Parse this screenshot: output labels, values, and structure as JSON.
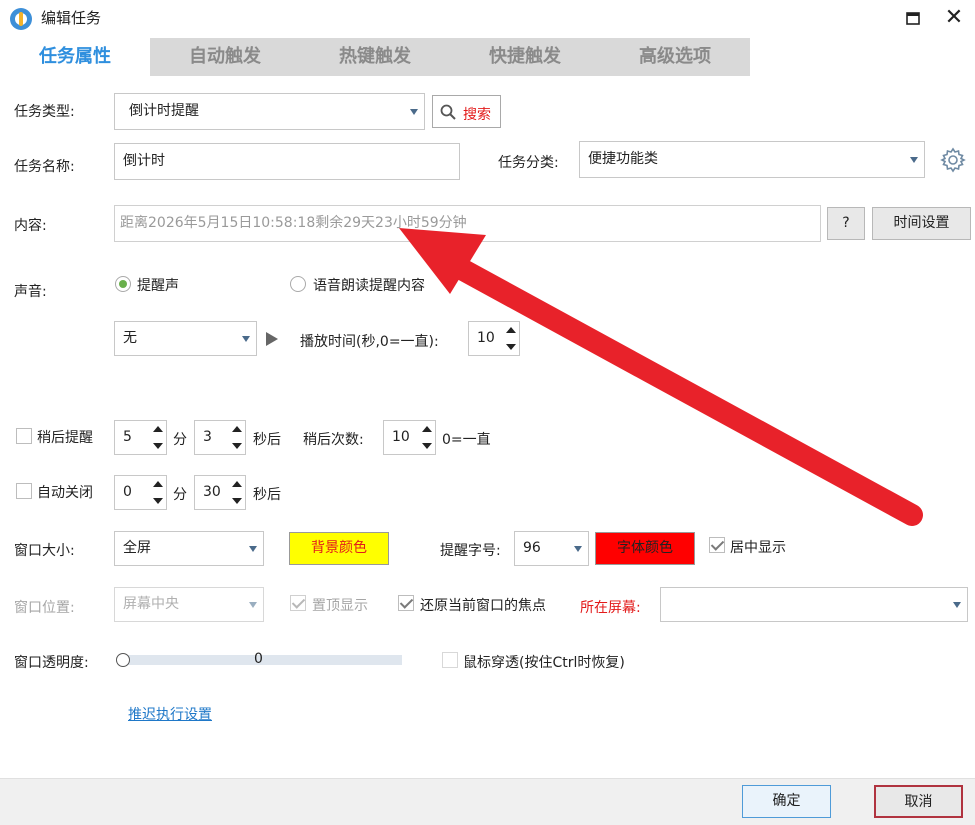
{
  "window": {
    "title": "编辑任务",
    "close_glyph": "✕"
  },
  "tabs": [
    {
      "label": "任务属性",
      "active": true
    },
    {
      "label": "自动触发",
      "active": false
    },
    {
      "label": "热键触发",
      "active": false
    },
    {
      "label": "快捷触发",
      "active": false
    },
    {
      "label": "高级选项",
      "active": false
    }
  ],
  "task": {
    "type_label": "任务类型:",
    "type_value": "倒计时提醒",
    "search_label": "搜索",
    "name_label": "任务名称:",
    "name_value": "倒计时",
    "category_label": "任务分类:",
    "category_value": "便捷功能类"
  },
  "content": {
    "label": "内容:",
    "value": "距离2026年5月15日10:58:18剩余29天23小时59分钟",
    "help_label": "?",
    "time_settings_label": "时间设置"
  },
  "sound": {
    "label": "声音:",
    "option_beep": "提醒声",
    "option_speech": "语音朗读提醒内容",
    "selected": "beep",
    "sound_value": "无",
    "play_time_label": "播放时间(秒,0=一直):",
    "play_time_value": "10"
  },
  "snooze": {
    "label": "稍后提醒",
    "checked": false,
    "minutes": "5",
    "min_unit": "分",
    "seconds": "3",
    "sec_unit": "秒后",
    "count_label": "稍后次数:",
    "count_value": "10",
    "count_hint": "0=一直"
  },
  "autoclose": {
    "label": "自动关闭",
    "checked": false,
    "minutes": "0",
    "min_unit": "分",
    "seconds": "30",
    "sec_unit": "秒后"
  },
  "window_opts": {
    "size_label": "窗口大小:",
    "size_value": "全屏",
    "bg_color_label": "背景颜色",
    "bg_color": "#ffff00",
    "font_size_label": "提醒字号:",
    "font_size_value": "96",
    "font_color_label": "字体颜色",
    "font_color": "#ff0000",
    "center_label": "居中显示",
    "center_checked": true,
    "position_label": "窗口位置:",
    "position_value": "屏幕中央",
    "topmost_label": "置顶显示",
    "topmost_checked": true,
    "restore_focus_label": "还原当前窗口的焦点",
    "restore_focus_checked": true,
    "screen_label": "所在屏幕:",
    "screen_value": "",
    "opacity_label": "窗口透明度:",
    "opacity_value": "0",
    "clickthrough_label": "鼠标穿透(按住Ctrl时恢复)",
    "clickthrough_checked": false
  },
  "delay_link": "推迟执行设置",
  "footer": {
    "ok_label": "确定",
    "cancel_label": "取消"
  },
  "annotation": {
    "arrow_color": "#e8222a"
  }
}
